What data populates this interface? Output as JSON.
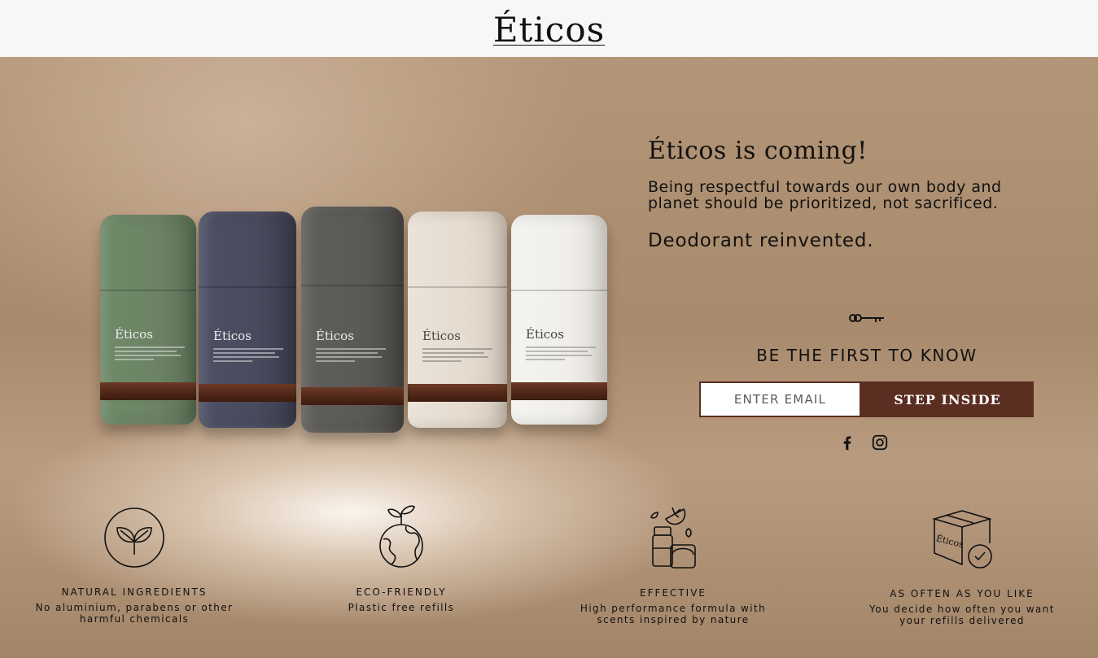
{
  "header": {
    "logo": "Éticos"
  },
  "hero": {
    "headline": "Éticos is coming!",
    "paragraph": "Being respectful towards our own body and planet should be prioritized, not sacrificed.",
    "subheadline": "Deodorant reinvented."
  },
  "products": {
    "brand": "Éticos",
    "colors": [
      "#6c8566",
      "#4a4d60",
      "#5d5b57",
      "#e6ddd2",
      "#f2f0ec"
    ]
  },
  "signup": {
    "title": "BE THE FIRST TO KNOW",
    "email_placeholder": "ENTER EMAIL",
    "button_label": "STEP INSIDE",
    "accent_color": "#5b2e22"
  },
  "social": {
    "icons": [
      "facebook-icon",
      "instagram-icon"
    ]
  },
  "features": [
    {
      "icon": "leaf-icon",
      "title": "NATURAL INGREDIENTS",
      "description": "No aluminium, parabens or other harmful chemicals"
    },
    {
      "icon": "globe-sprout-icon",
      "title": "ECO-FRIENDLY",
      "description": "Plastic free refills"
    },
    {
      "icon": "deodorant-scent-icon",
      "title": "EFFECTIVE",
      "description": "High performance formula with scents inspired by nature"
    },
    {
      "icon": "delivery-box-icon",
      "title": "AS OFTEN AS YOU LIKE",
      "description": "You decide how often you want your refills delivered",
      "box_label": "Éticos"
    }
  ]
}
